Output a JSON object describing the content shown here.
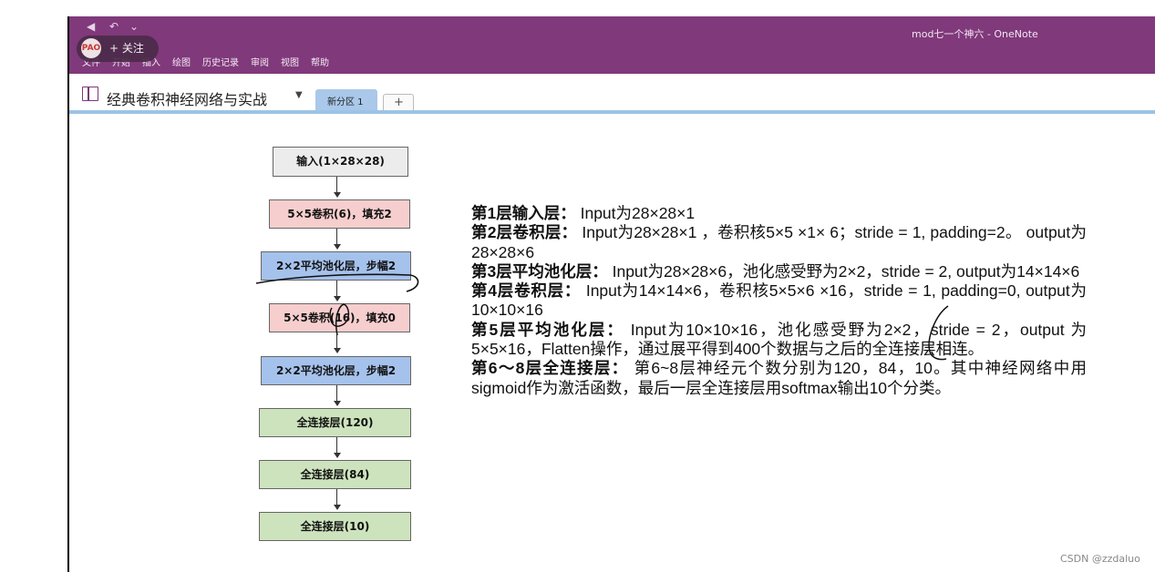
{
  "window": {
    "title": "mod七一个神六 - OneNote"
  },
  "menu": [
    "文件",
    "开始",
    "插入",
    "绘图",
    "历史记录",
    "审阅",
    "视图",
    "帮助"
  ],
  "follow": {
    "avatar": "PAO",
    "label": "+ 关注"
  },
  "notebook": {
    "title": "经典卷积神经网络与实战",
    "section_tab": "新分区 1",
    "add_tab": "+"
  },
  "diagram": {
    "boxes": [
      "输入(1×28×28)",
      "5×5卷积(6)，填充2",
      "2×2平均池化层，步幅2",
      "5×5卷积(16)，填充0",
      "2×2平均池化层，步幅2",
      "全连接层(120)",
      "全连接层(84)",
      "全连接层(10)"
    ]
  },
  "notes": [
    {
      "head": "第1层输入层：",
      "body": " Input为28×28×1"
    },
    {
      "head": "第2层卷积层：",
      "body": " Input为28×28×1 ，卷积核5×5 ×1× 6；stride = 1, padding=2。 output为28×28×6"
    },
    {
      "head": "第3层平均池化层：",
      "body": " Input为28×28×6，池化感受野为2×2，stride = 2, output为14×14×6"
    },
    {
      "head": "第4层卷积层：",
      "body": " Input为14×14×6，卷积核5×5×6 ×16，stride = 1, padding=0, output为10×10×16"
    },
    {
      "head": "第5层平均池化层：",
      "body": " Input为10×10×16，池化感受野为2×2，stride = 2，output 为5×5×16，Flatten操作，通过展平得到400个数据与之后的全连接层相连。"
    },
    {
      "head": "第6～8层全连接层：",
      "body": " 第6~8层神经元个数分别为120，84，10。其中神经网络中用sigmoid作为激活函数，最后一层全连接层用softmax输出10个分类。"
    }
  ],
  "watermark": "CSDN @zzdaluo"
}
